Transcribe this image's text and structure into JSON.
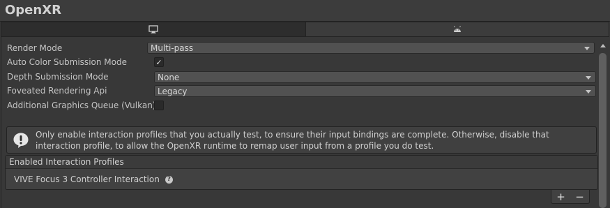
{
  "window": {
    "title": "OpenXR"
  },
  "tabs": [
    {
      "icon": "monitor-icon",
      "selected": true
    },
    {
      "icon": "android-icon",
      "selected": false
    }
  ],
  "settings": {
    "render_mode": {
      "label": "Render Mode",
      "value": "Multi-pass"
    },
    "auto_color": {
      "label": "Auto Color Submission Mode",
      "checked": true,
      "check_glyph": "✓"
    },
    "depth_submission": {
      "label": "Depth Submission Mode",
      "value": "None"
    },
    "foveated": {
      "label": "Foveated Rendering Api",
      "value": "Legacy"
    },
    "additional_queue": {
      "label": "Additional Graphics Queue (Vulkan)",
      "checked": false
    }
  },
  "help_box": {
    "icon": "warning-icon",
    "text": "Only enable interaction profiles that you actually test, to ensure their input bindings are complete. Otherwise, disable that interaction profile, to allow the OpenXR runtime to remap user input from a profile you do test."
  },
  "interaction_profiles": {
    "header": "Enabled Interaction Profiles",
    "items": [
      {
        "label": "VIVE Focus 3 Controller Interaction",
        "help_glyph": "?"
      }
    ],
    "add_label": "+",
    "remove_label": "−"
  }
}
